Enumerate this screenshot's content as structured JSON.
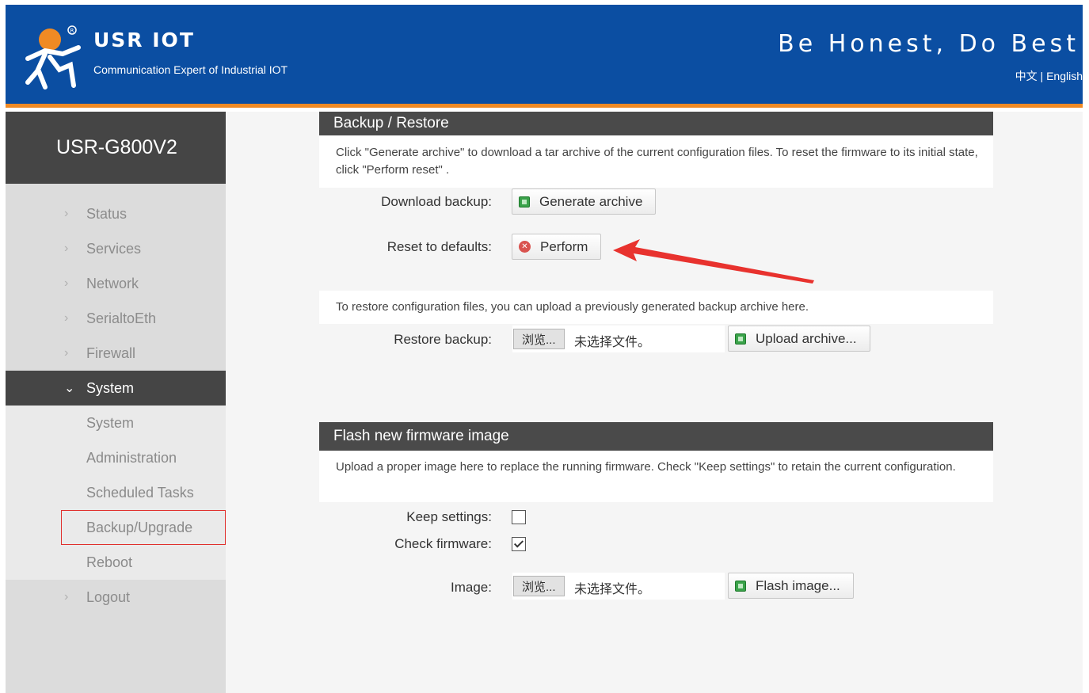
{
  "header": {
    "brand": "USR IOT",
    "brand_subtitle": "Communication Expert of Industrial IOT",
    "slogan": "Be Honest, Do Best",
    "lang_chinese": "中文",
    "lang_separator": "|",
    "lang_english": "English",
    "bg_color": "#0b4ea2",
    "accent_color": "#f08a24"
  },
  "sidebar": {
    "device_name": "USR-G800V2",
    "items": [
      {
        "label": "Status"
      },
      {
        "label": "Services"
      },
      {
        "label": "Network"
      },
      {
        "label": "SerialtoEth"
      },
      {
        "label": "Firewall"
      },
      {
        "label": "System"
      },
      {
        "label": "Logout"
      }
    ],
    "system_sub": [
      {
        "label": "System"
      },
      {
        "label": "Administration"
      },
      {
        "label": "Scheduled Tasks"
      },
      {
        "label": "Backup/Upgrade"
      },
      {
        "label": "Reboot"
      }
    ]
  },
  "backup": {
    "title": "Backup / Restore",
    "description": "Click \"Generate archive\" to download a tar archive of the current configuration files. To reset the firmware to its initial state, click \"Perform reset\" .",
    "download_label": "Download backup:",
    "generate_button": "Generate archive",
    "reset_label": "Reset to defaults:",
    "perform_button": "Perform",
    "restore_description": "To restore configuration files, you can upload a previously generated backup archive here.",
    "restore_label": "Restore backup:",
    "browse_button": "浏览...",
    "no_file_text": "未选择文件。",
    "upload_button": "Upload archive..."
  },
  "firmware": {
    "title": "Flash new firmware image",
    "description": "Upload a proper image here to replace the running firmware. Check \"Keep settings\" to retain the current configuration.",
    "keep_label": "Keep settings:",
    "keep_checked": false,
    "check_label": "Check firmware:",
    "check_checked": true,
    "image_label": "Image:",
    "browse_button": "浏览...",
    "no_file_text": "未选择文件。",
    "flash_button": "Flash image..."
  }
}
